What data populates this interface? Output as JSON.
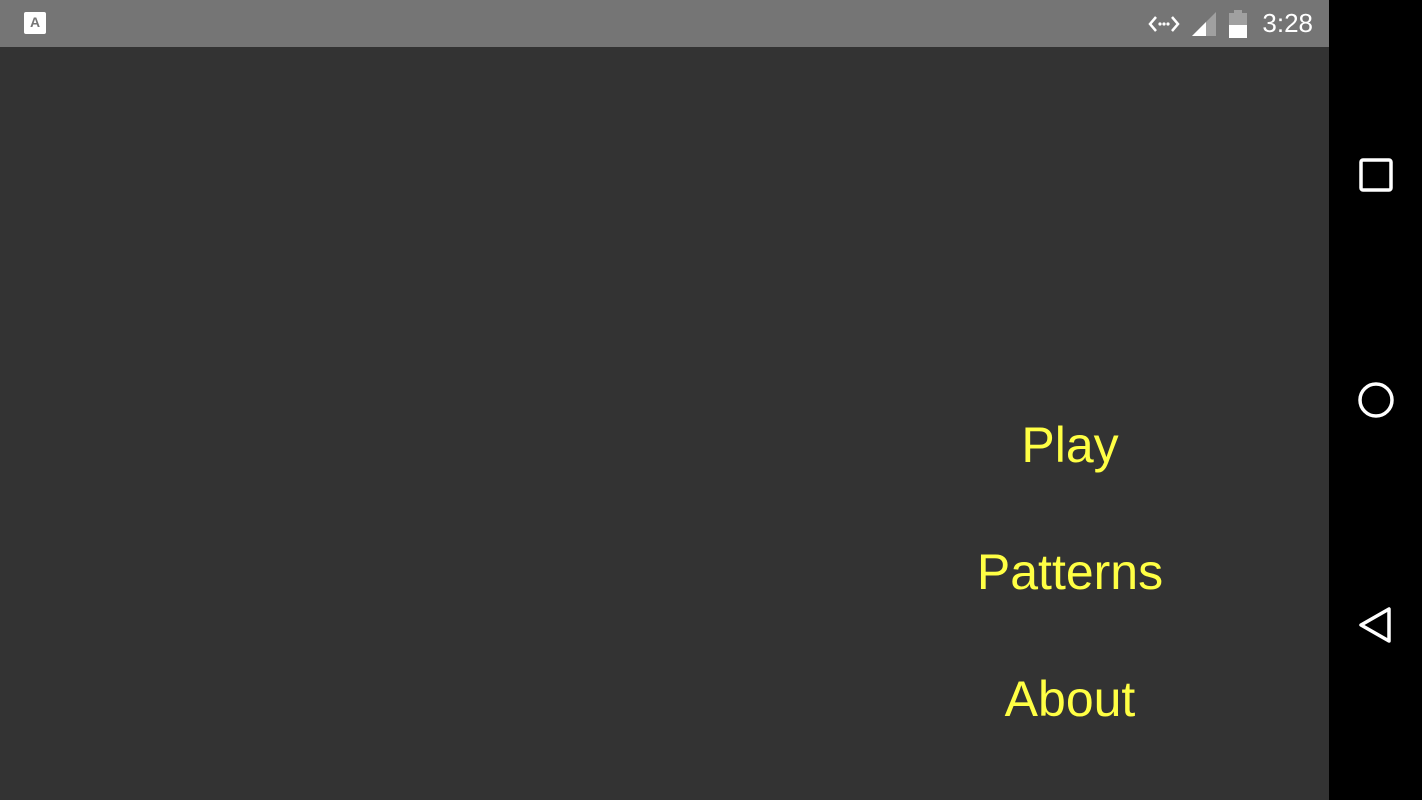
{
  "status_bar": {
    "app_icon_letter": "A",
    "time": "3:28",
    "icons": [
      "app-notification-icon",
      "data-transfer-icon",
      "cell-signal-icon",
      "battery-icon"
    ]
  },
  "menu": {
    "items": [
      {
        "label": "Play"
      },
      {
        "label": "Patterns"
      },
      {
        "label": "About"
      }
    ]
  },
  "nav_bar": {
    "buttons": [
      "recents-icon",
      "home-icon",
      "back-icon"
    ]
  },
  "colors": {
    "status_bar_bg": "#757575",
    "app_bg": "#333333",
    "menu_text": "#ffff44",
    "nav_bar_bg": "#000000"
  }
}
